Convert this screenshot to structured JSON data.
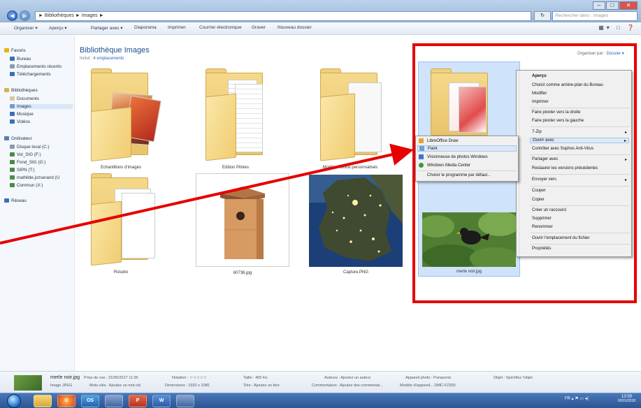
{
  "window": {
    "breadcrumb": "► Bibliothèques ► Images ►",
    "search_placeholder": "Rechercher dans : Images",
    "controls": [
      "–",
      "□",
      "✕"
    ]
  },
  "toolbar": {
    "items": [
      "Organiser ▾",
      "Aperçu ▾",
      "Partager avec ▾",
      "Diaporama",
      "Imprimer",
      "Courrier électronique",
      "Graver",
      "Nouveau dossier"
    ]
  },
  "sidebar": {
    "items": [
      {
        "label": "Favoris",
        "color": "#e8b400"
      },
      {
        "label": "Bureau",
        "color": "#3a6fb5"
      },
      {
        "label": "Emplacements récents",
        "color": "#8a9bb0"
      },
      {
        "label": "Téléchargements",
        "color": "#3a6fb5"
      },
      {
        "label": "Bibliothèques",
        "color": "#d8b24a"
      },
      {
        "label": "Documents",
        "color": "#d8c89a"
      },
      {
        "label": "Images",
        "color": "#6c9fd4"
      },
      {
        "label": "Musique",
        "color": "#3a6fb5"
      },
      {
        "label": "Vidéos",
        "color": "#3a6fb5"
      },
      {
        "label": "Ordinateur",
        "color": "#5b7fa8"
      },
      {
        "label": "Disque local (C:)",
        "color": "#8a9bb0"
      },
      {
        "label": "Vol_SIG (F:)",
        "color": "#4a8b4a"
      },
      {
        "label": "Fond_SIG (G:)",
        "color": "#4a8b4a"
      },
      {
        "label": "SIPN (T:)",
        "color": "#4a8b4a"
      },
      {
        "label": "mathilde.jozserand (U",
        "color": "#4a8b4a"
      },
      {
        "label": "Commun (X:)",
        "color": "#4a8b4a"
      },
      {
        "label": "Réseau",
        "color": "#3a6fb5"
      }
    ]
  },
  "library": {
    "title": "Bibliothèque Images",
    "subtitle_prefix": "Inclut :",
    "subtitle_link": "4 emplacements",
    "arrange_prefix": "Organiser par :",
    "arrange_value": "Dossier ▾"
  },
  "items": [
    {
      "caption": "Echantillons d'images"
    },
    {
      "caption": "Edition Pilotes"
    },
    {
      "caption": "Modèles Office personnalisés"
    },
    {
      "caption": "Rstudio"
    },
    {
      "caption": "60736.jpg"
    },
    {
      "caption": "Capture.PNG"
    },
    {
      "caption": "merle noir.jpg"
    }
  ],
  "context_menu": {
    "items": [
      "Aperçu",
      "Choisir comme arrière-plan du Bureau",
      "Modifier",
      "Imprimer",
      "Faire pivoter vers la droite",
      "Faire pivoter vers la gauche",
      "7-Zip",
      "Ouvrir avec",
      "Contrôler avec Sophos Anti-Virus",
      "Partager avec",
      "Restaurer les versions précédentes",
      "Envoyer vers",
      "Couper",
      "Copier",
      "Créer un raccourci",
      "Supprimer",
      "Renommer",
      "Ouvrir l'emplacement du fichier",
      "Propriétés"
    ]
  },
  "submenu": {
    "items": [
      "LibreOffice Draw",
      "Paint",
      "Visionneuse de photos Windows",
      "Windows Media Center",
      "Choisir le programme par défaut..."
    ]
  },
  "details": {
    "filename": "merle noir.jpg",
    "filetype": "Image JPEG",
    "date": "Prise de vue : 31/05/2017 11:35",
    "tags": "Mots-clés : Ajoutez un mot-clé",
    "rating_label": "Notation :",
    "rating_stars": "☆☆☆☆☆",
    "dimensions": "Dimensions : 1920 x 1080",
    "size": "Taille : 465 Ko",
    "title": "Titre : Ajoutez un titre",
    "authors": "Auteurs : Ajoutez un auteur",
    "comments": "Commentaires : Ajoutez des commentai...",
    "camera_maker": "Appareil photo : Panasonic",
    "camera_model": "Modèle d'appareil... DMC-FZ300",
    "subject": "Objet : Spécifiez l'objet"
  },
  "taskbar": {
    "buttons": [
      "",
      "",
      "O",
      "OS",
      "",
      "P",
      "W",
      ""
    ],
    "tray": "FR  ▴  ⚑  ▭  ◂)",
    "time": "13:59",
    "date": "02/01/2018"
  },
  "colors": {
    "annotation": "#e60000",
    "selection": "#cfe3fb",
    "link": "#2a62b8"
  }
}
